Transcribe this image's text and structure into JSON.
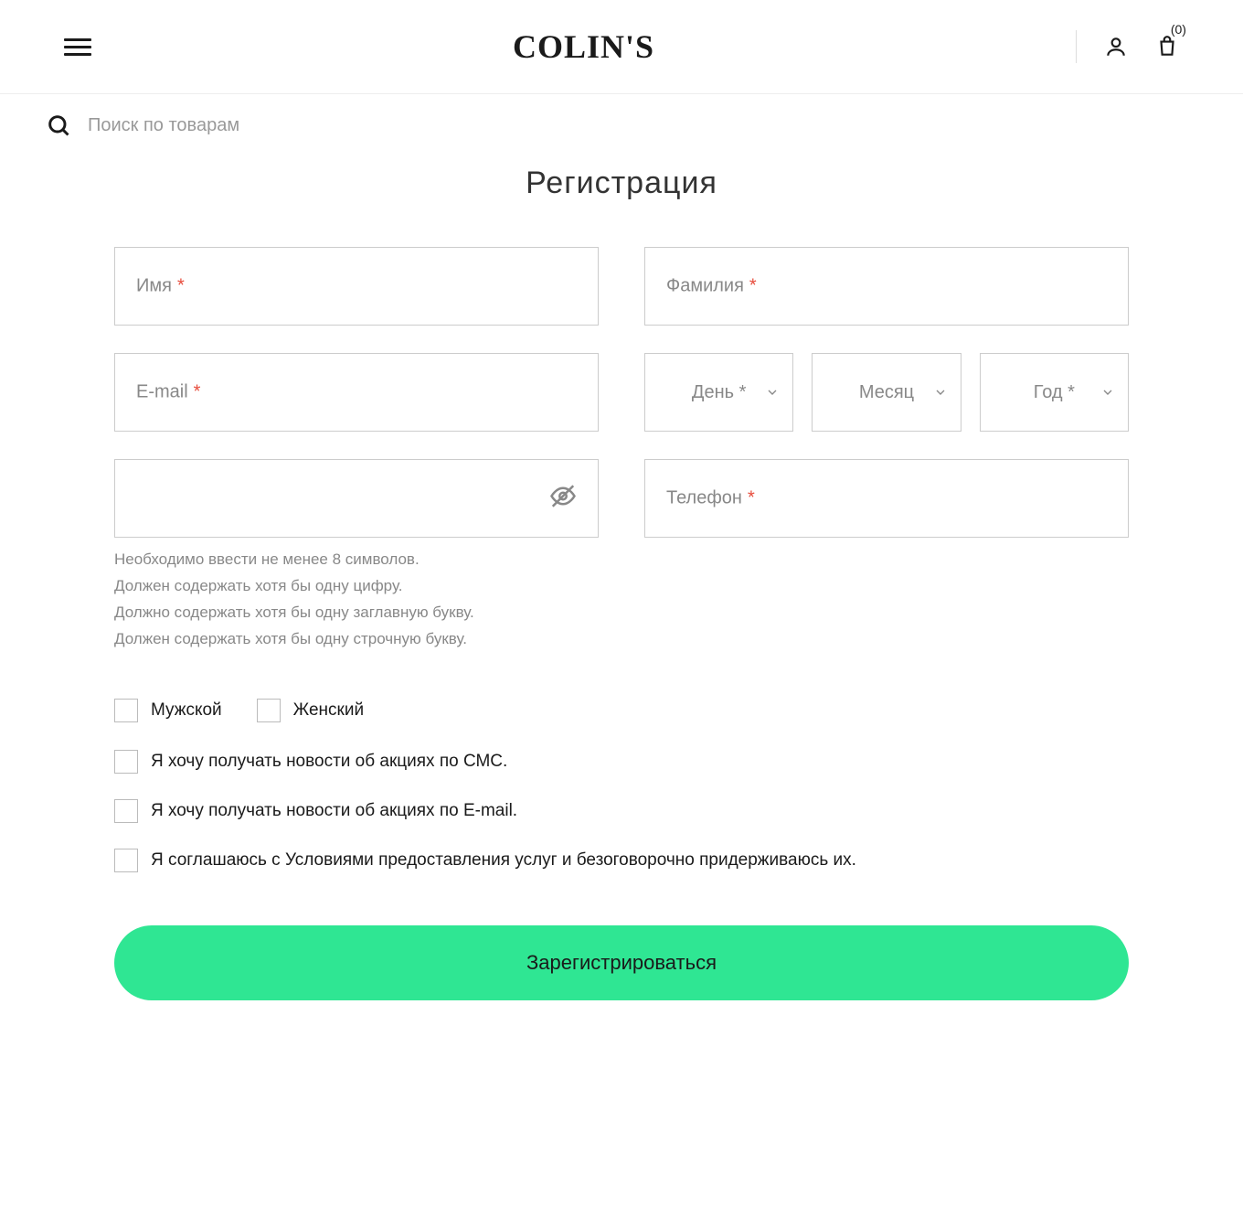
{
  "header": {
    "logo": "COLIN'S",
    "cart_count": "(0)"
  },
  "search": {
    "placeholder": "Поиск по товарам"
  },
  "page": {
    "title": "Регистрация"
  },
  "form": {
    "first_name_label": "Имя",
    "last_name_label": "Фамилия",
    "email_label": "E-mail",
    "day_label": "День *",
    "month_label": "Месяц",
    "year_label": "Год *",
    "phone_label": "Телефон",
    "asterisk": "*",
    "hints": {
      "h1": "Необходимо ввести не менее 8 символов.",
      "h2": "Должен содержать хотя бы одну цифру.",
      "h3": "Должно содержать хотя бы одну заглавную букву.",
      "h4": "Должен содержать хотя бы одну строчную букву."
    },
    "gender_male": "Мужской",
    "gender_female": "Женский",
    "sms_opt": "Я хочу получать новости об акциях по СМС.",
    "email_opt": "Я хочу получать новости об акциях по E-mail.",
    "terms": "Я соглашаюсь с Условиями предоставления услуг и безоговорочно придерживаюсь их.",
    "submit": "Зарегистрироваться"
  }
}
